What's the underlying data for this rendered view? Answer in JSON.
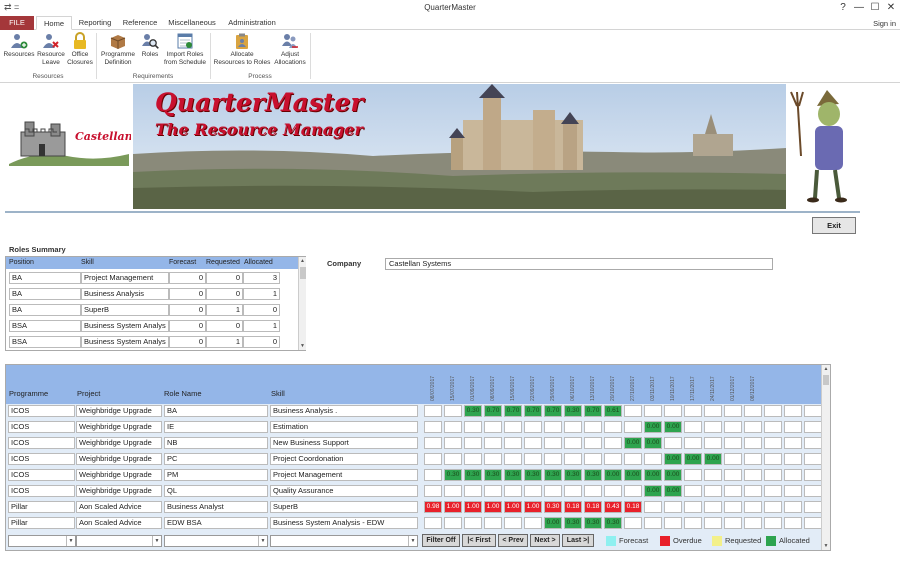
{
  "titlebar": {
    "title": "QuarterMaster",
    "quick_access": "⇄ =",
    "help": "?",
    "minimize": "—",
    "restore": "☐",
    "close": "✕"
  },
  "tabs": [
    "FILE",
    "Home",
    "Reporting",
    "Reference",
    "Miscellaneous",
    "Administration"
  ],
  "sign_in": "Sign in",
  "ribbon": {
    "buttons": [
      {
        "line1": "Resources",
        "line2": "",
        "icon": "resources-icon"
      },
      {
        "line1": "Resource",
        "line2": "Leave",
        "icon": "resource-leave-icon"
      },
      {
        "line1": "Office",
        "line2": "Closures",
        "icon": "office-closures-icon"
      },
      {
        "line1": "Programme",
        "line2": "Definition",
        "icon": "programme-definition-icon"
      },
      {
        "line1": "Roles",
        "line2": "",
        "icon": "roles-icon"
      },
      {
        "line1": "Import Roles",
        "line2": "from Schedule",
        "icon": "import-roles-icon"
      },
      {
        "line1": "Allocate",
        "line2": "Resources to Roles",
        "icon": "allocate-icon"
      },
      {
        "line1": "Adjust",
        "line2": "Allocations",
        "icon": "adjust-allocations-icon"
      }
    ],
    "groups": [
      "Resources",
      "Requirements",
      "Process"
    ]
  },
  "banner": {
    "app_title": "QuarterMaster",
    "app_subtitle": "The Resource Manager",
    "logo_text": "Castellan"
  },
  "exit_label": "Exit",
  "roles_summary": {
    "title": "Roles Summary",
    "columns": [
      "Position",
      "Skill",
      "Forecast",
      "Requested",
      "Allocated"
    ],
    "rows": [
      {
        "position": "BA",
        "skill": "Project Management",
        "forecast": "0",
        "requested": "0",
        "allocated": "3"
      },
      {
        "position": "BA",
        "skill": "Business Analysis",
        "forecast": "0",
        "requested": "0",
        "allocated": "1"
      },
      {
        "position": "BA",
        "skill": "SuperB",
        "forecast": "0",
        "requested": "1",
        "allocated": "0"
      },
      {
        "position": "BSA",
        "skill": "Business System Analys",
        "forecast": "0",
        "requested": "0",
        "allocated": "1"
      },
      {
        "position": "BSA",
        "skill": "Business System Analys",
        "forecast": "0",
        "requested": "1",
        "allocated": "0"
      }
    ]
  },
  "company": {
    "label": "Company",
    "value": "Castellan Systems"
  },
  "allocations": {
    "columns": [
      "Programme",
      "Project",
      "Role Name",
      "Skill"
    ],
    "dates": [
      "08/07/2017",
      "15/07/2017",
      "01/09/2017",
      "08/09/2017",
      "15/09/2017",
      "22/09/2017",
      "29/09/2017",
      "06/10/2017",
      "13/10/2017",
      "20/10/2017",
      "27/10/2017",
      "03/11/2017",
      "10/11/2017",
      "17/11/2017",
      "24/11/2017",
      "01/12/2017",
      "08/12/2017"
    ],
    "rows": [
      {
        "programme": "ICOS",
        "project": "Weighbridge Upgrade",
        "role": "BA",
        "skill": "Business Analysis .",
        "cells": [
          "",
          "",
          "A:0.30",
          "A:0.70",
          "A:0.70",
          "A:0.70",
          "A:0.70",
          "A:0.30",
          "A:0.70",
          "A:0.61",
          "",
          "",
          "",
          "",
          "",
          "",
          "",
          "",
          "",
          "",
          ""
        ]
      },
      {
        "programme": "ICOS",
        "project": "Weighbridge Upgrade",
        "role": "IE",
        "skill": "Estimation",
        "cells": [
          "",
          "",
          "",
          "",
          "",
          "",
          "",
          "",
          "",
          "",
          "",
          "A:0.00",
          "A:0.00",
          "",
          "",
          "",
          "",
          "",
          "",
          "",
          ""
        ]
      },
      {
        "programme": "ICOS",
        "project": "Weighbridge Upgrade",
        "role": "NB",
        "skill": "New Business Support",
        "cells": [
          "",
          "",
          "",
          "",
          "",
          "",
          "",
          "",
          "",
          "",
          "A:0.00",
          "A:0.00",
          "",
          "",
          "",
          "",
          "",
          "",
          "",
          "",
          ""
        ]
      },
      {
        "programme": "ICOS",
        "project": "Weighbridge Upgrade",
        "role": "PC",
        "skill": "Project Coordonation",
        "cells": [
          "",
          "",
          "",
          "",
          "",
          "",
          "",
          "",
          "",
          "",
          "",
          "",
          "A:0.00",
          "A:0.00",
          "A:0.00",
          "",
          "",
          "",
          "",
          "",
          ""
        ]
      },
      {
        "programme": "ICOS",
        "project": "Weighbridge Upgrade",
        "role": "PM",
        "skill": "Project Management",
        "cells": [
          "",
          "A:0.30",
          "A:0.30",
          "A:0.30",
          "A:0.30",
          "A:0.30",
          "A:0.30",
          "A:0.30",
          "A:0.30",
          "A:0.00",
          "A:0.00",
          "A:0.00",
          "A:0.00",
          "",
          "",
          "",
          "",
          "",
          "",
          "",
          ""
        ]
      },
      {
        "programme": "ICOS",
        "project": "Weighbridge Upgrade",
        "role": "QL",
        "skill": "Quality Assurance",
        "cells": [
          "",
          "",
          "",
          "",
          "",
          "",
          "",
          "",
          "",
          "",
          "",
          "A:0.00",
          "A:0.00",
          "",
          "",
          "",
          "",
          "",
          "",
          "",
          ""
        ]
      },
      {
        "programme": "Pillar",
        "project": "Aon Scaled Advice",
        "role": "Business Analyst",
        "skill": "SuperB",
        "cells": [
          "O:0.98",
          "O:1.00",
          "O:1.00",
          "O:1.00",
          "O:1.00",
          "O:1.00",
          "O:0.30",
          "O:0.18",
          "O:0.18",
          "O:0.43",
          "O:0.18",
          "",
          "",
          "",
          "",
          "",
          "",
          "",
          "",
          "",
          ""
        ]
      },
      {
        "programme": "Pillar",
        "project": "Aon Scaled Advice",
        "role": "EDW BSA",
        "skill": "Business System Analysis - EDW",
        "cells": [
          "",
          "",
          "",
          "",
          "",
          "",
          "A:0.00",
          "A:0.30",
          "A:0.30",
          "A:0.30",
          "",
          "",
          "",
          "",
          "",
          "",
          "",
          "",
          "",
          "",
          ""
        ]
      }
    ]
  },
  "nav_buttons": [
    "Filter Off",
    "|< First",
    "< Prev",
    "Next >",
    "Last >|"
  ],
  "legend": [
    {
      "label": "Forecast",
      "color": "#8ff0f0"
    },
    {
      "label": "Overdue",
      "color": "#e8202a"
    },
    {
      "label": "Requested",
      "color": "#f3f08a"
    },
    {
      "label": "Allocated",
      "color": "#2ea44f"
    }
  ]
}
